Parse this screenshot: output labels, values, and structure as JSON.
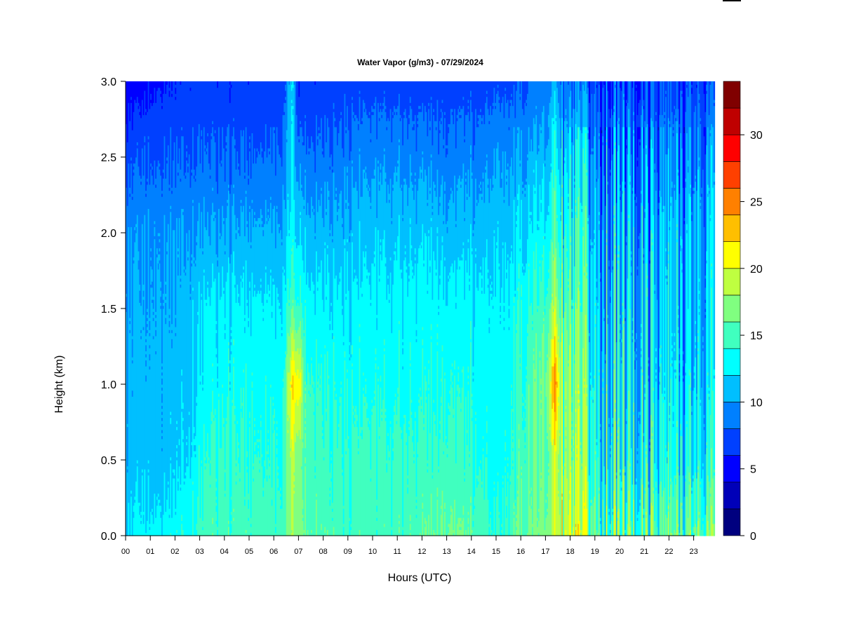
{
  "chart_data": {
    "type": "heatmap",
    "title": "Water Vapor (g/m3) - 07/29/2024",
    "xlabel": "Hours (UTC)",
    "ylabel": "Height (km)",
    "xlim": [
      0,
      23.85
    ],
    "ylim": [
      0,
      3.0
    ],
    "x_ticks": [
      "00",
      "01",
      "02",
      "03",
      "04",
      "05",
      "06",
      "07",
      "08",
      "09",
      "10",
      "11",
      "12",
      "13",
      "14",
      "15",
      "16",
      "17",
      "18",
      "19",
      "20",
      "21",
      "22",
      "23"
    ],
    "y_ticks": [
      "0.0",
      "0.5",
      "1.0",
      "1.5",
      "2.0",
      "2.5",
      "3.0"
    ],
    "colorbar": {
      "range": [
        0,
        34
      ],
      "step": 2,
      "ticks": [
        "0",
        "5",
        "10",
        "15",
        "20",
        "25",
        "30"
      ],
      "colors": [
        "#00007F",
        "#0000B8",
        "#0000FF",
        "#0040FF",
        "#0080FF",
        "#00BFFF",
        "#00FFFF",
        "#40FFBF",
        "#80FF80",
        "#BFFF40",
        "#FFFF00",
        "#FFBF00",
        "#FF8000",
        "#FF4000",
        "#FF0000",
        "#BF0000",
        "#800000"
      ]
    },
    "heights_km": [
      0,
      0.5,
      1.0,
      1.5,
      2.0,
      2.5,
      3.0
    ],
    "profiles": [
      {
        "hour": 0.0,
        "values": [
          11.5,
          10.5,
          10.5,
          10.0,
          9.5,
          7.0,
          5.0
        ],
        "variability": 0.6
      },
      {
        "hour": 0.5,
        "values": [
          12.5,
          11.0,
          10.5,
          10.2,
          9.5,
          7.5,
          5.0
        ],
        "variability": 0.6
      },
      {
        "hour": 1.5,
        "values": [
          13.0,
          11.0,
          11.0,
          10.5,
          10.0,
          8.0,
          6.0
        ],
        "variability": 0.7
      },
      {
        "hour": 2.5,
        "values": [
          14.0,
          12.0,
          11.5,
          11.0,
          10.0,
          8.0,
          6.5
        ],
        "variability": 0.8
      },
      {
        "hour": 3.5,
        "values": [
          15.0,
          14.5,
          13.0,
          12.5,
          10.0,
          8.0,
          6.5
        ],
        "variability": 0.8
      },
      {
        "hour": 5.0,
        "values": [
          15.0,
          14.2,
          13.5,
          12.5,
          10.5,
          8.0,
          6.5
        ],
        "variability": 0.8
      },
      {
        "hour": 6.4,
        "values": [
          15.0,
          14.0,
          13.5,
          12.5,
          10.5,
          8.5,
          7.0
        ],
        "variability": 0.8
      },
      {
        "hour": 6.75,
        "values": [
          17.5,
          19.0,
          22.0,
          15.5,
          13.0,
          12.0,
          12.0
        ],
        "variability": 0.8
      },
      {
        "hour": 7.0,
        "values": [
          17.0,
          16.5,
          21.5,
          14.5,
          12.0,
          9.0,
          5.5
        ],
        "variability": 0.8
      },
      {
        "hour": 7.3,
        "values": [
          16.0,
          15.0,
          14.5,
          13.0,
          11.0,
          8.5,
          6.5
        ],
        "variability": 0.8
      },
      {
        "hour": 9.0,
        "values": [
          15.0,
          14.5,
          13.5,
          12.5,
          11.0,
          9.0,
          7.0
        ],
        "variability": 0.8
      },
      {
        "hour": 11.0,
        "values": [
          15.0,
          14.5,
          13.5,
          12.8,
          11.5,
          9.5,
          7.0
        ],
        "variability": 0.8
      },
      {
        "hour": 12.5,
        "values": [
          16.0,
          14.5,
          13.5,
          13.0,
          11.5,
          9.0,
          7.0
        ],
        "variability": 0.8
      },
      {
        "hour": 13.0,
        "values": [
          16.5,
          15.0,
          14.0,
          13.0,
          11.0,
          9.0,
          7.0
        ],
        "variability": 0.8
      },
      {
        "hour": 14.5,
        "values": [
          15.0,
          13.5,
          13.0,
          12.5,
          11.0,
          9.0,
          7.0
        ],
        "variability": 0.8
      },
      {
        "hour": 15.0,
        "values": [
          14.0,
          13.0,
          13.0,
          12.5,
          11.5,
          10.0,
          7.5
        ],
        "variability": 0.8
      },
      {
        "hour": 16.0,
        "values": [
          16.0,
          15.0,
          14.5,
          13.5,
          12.0,
          10.0,
          7.5
        ],
        "variability": 1.0
      },
      {
        "hour": 17.0,
        "values": [
          17.0,
          16.0,
          16.5,
          15.0,
          13.0,
          11.0,
          9.0
        ],
        "variability": 1.2
      },
      {
        "hour": 17.4,
        "values": [
          20.0,
          20.0,
          25.0,
          19.0,
          16.0,
          14.0,
          11.0
        ],
        "variability": 1.2
      },
      {
        "hour": 17.7,
        "values": [
          19.0,
          17.0,
          17.0,
          15.0,
          13.0,
          11.0,
          8.0
        ],
        "variability": 4.5
      },
      {
        "hour": 19.0,
        "values": [
          16.0,
          14.0,
          13.0,
          12.0,
          11.0,
          9.5,
          7.0
        ],
        "variability": 5.0
      },
      {
        "hour": 21.0,
        "values": [
          15.5,
          13.0,
          12.0,
          11.5,
          10.5,
          9.0,
          7.0
        ],
        "variability": 4.5
      },
      {
        "hour": 23.9,
        "values": [
          16.0,
          13.0,
          11.5,
          11.0,
          10.5,
          9.0,
          7.0
        ],
        "variability": 3.5
      }
    ]
  }
}
